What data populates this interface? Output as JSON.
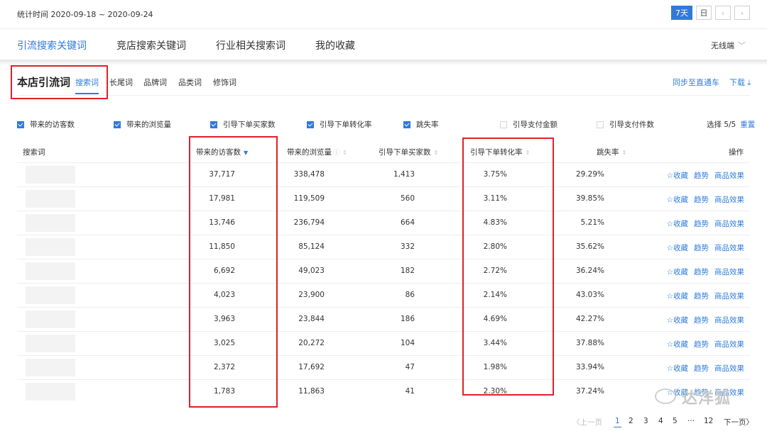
{
  "header": {
    "stat_time": "统计时间 2020-09-18 ~ 2020-09-24",
    "period_buttons": [
      "7天",
      "日"
    ],
    "prev_icon": "chevron-left-icon",
    "next_icon": "chevron-right-icon"
  },
  "tabs": [
    "引流搜索关键词",
    "竞店搜索关键词",
    "行业相关搜索词",
    "我的收藏"
  ],
  "device": {
    "label": "无线端",
    "icon": "chevron-down-icon"
  },
  "section": {
    "title": "本店引流词",
    "subtabs": [
      "搜索词",
      "长尾词",
      "品牌词",
      "品类词",
      "修饰词"
    ],
    "sync_label": "同步至直通车",
    "download_label": "下载",
    "download_icon": "download-icon"
  },
  "metrics": [
    {
      "label": "带来的访客数",
      "checked": true
    },
    {
      "label": "带来的浏览量",
      "checked": true
    },
    {
      "label": "引导下单买家数",
      "checked": true
    },
    {
      "label": "引导下单转化率",
      "checked": true
    },
    {
      "label": "跳失率",
      "checked": true
    },
    {
      "label": "引导支付金额",
      "checked": false
    },
    {
      "label": "引导支付件数",
      "checked": false
    }
  ],
  "selection": {
    "count": "选择 5/5",
    "reset": "重置"
  },
  "table": {
    "columns": [
      "搜索词",
      "带来的访客数",
      "带来的浏览量",
      "引导下单买家数",
      "引导下单转化率",
      "跳失率",
      "操作"
    ],
    "actions": [
      "☆收藏",
      "趋势",
      "商品效果"
    ],
    "rows": [
      [
        "37,717",
        "338,478",
        "1,413",
        "3.75%",
        "29.29%"
      ],
      [
        "17,981",
        "119,509",
        "560",
        "3.11%",
        "39.85%"
      ],
      [
        "13,746",
        "236,794",
        "664",
        "4.83%",
        "5.21%"
      ],
      [
        "11,850",
        "85,124",
        "332",
        "2.80%",
        "35.62%"
      ],
      [
        "6,692",
        "49,023",
        "182",
        "2.72%",
        "36.24%"
      ],
      [
        "4,023",
        "23,900",
        "86",
        "2.14%",
        "43.03%"
      ],
      [
        "3,963",
        "23,844",
        "186",
        "4.69%",
        "42.27%"
      ],
      [
        "3,025",
        "20,272",
        "104",
        "3.44%",
        "37.88%"
      ],
      [
        "2,372",
        "17,692",
        "47",
        "1.98%",
        "33.94%"
      ],
      [
        "1,783",
        "11,863",
        "41",
        "2.30%",
        "37.24%"
      ]
    ]
  },
  "pagination": {
    "prev": "〈上一页",
    "pages": [
      "1",
      "2",
      "3",
      "4",
      "5"
    ],
    "ellipsis": "···",
    "last": "12",
    "next": "下一页〉"
  },
  "watermark": "达洋狐",
  "colors": {
    "accent": "#2f7bd9",
    "highlight": "#e0202a"
  }
}
